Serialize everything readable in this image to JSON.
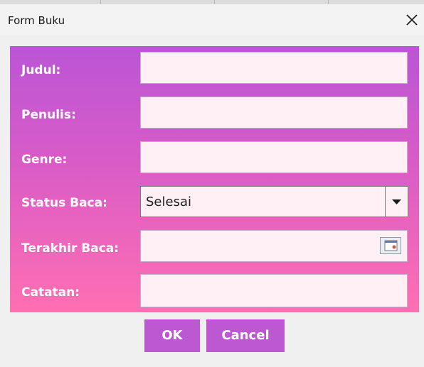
{
  "window": {
    "title": "Form Buku"
  },
  "form": {
    "fields": [
      {
        "label": "Judul:",
        "value": ""
      },
      {
        "label": "Penulis:",
        "value": ""
      },
      {
        "label": "Genre:",
        "value": ""
      }
    ],
    "status": {
      "label": "Status Baca:",
      "selected": "Selesai"
    },
    "last_read": {
      "label": "Terakhir Baca:",
      "value": ""
    },
    "notes": {
      "label": "Catatan:",
      "value": ""
    }
  },
  "buttons": {
    "ok": "OK",
    "cancel": "Cancel"
  },
  "colors": {
    "panel_top": "#bb55d6",
    "panel_bottom": "#ff6fb2",
    "field_bg": "#fff0f5",
    "button": "#bd58d3"
  },
  "icons": {
    "close": "close-icon",
    "dropdown": "chevron-down-icon",
    "calendar": "calendar-icon"
  }
}
